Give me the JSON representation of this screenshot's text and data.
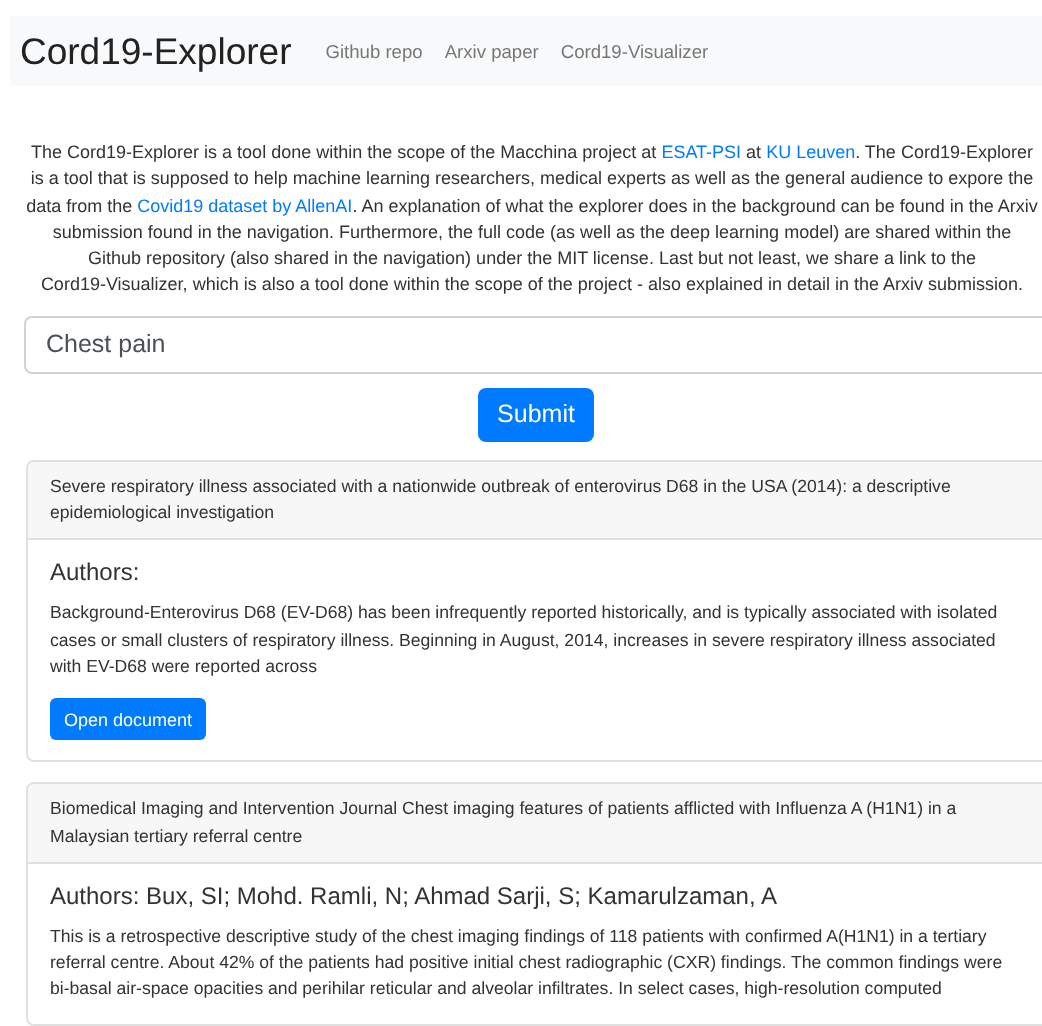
{
  "navbar": {
    "brand": "Cord19-Explorer",
    "links": [
      "Github repo",
      "Arxiv paper",
      "Cord19-Visualizer"
    ]
  },
  "intro": [
    {
      "kind": "text",
      "text": "The Cord19-Explorer is a tool done within the scope of the Macchina project at "
    },
    {
      "kind": "link",
      "text": "ESAT-PSI"
    },
    {
      "kind": "text",
      "text": " at "
    },
    {
      "kind": "link",
      "text": "KU Leuven"
    },
    {
      "kind": "text",
      "text": ". The Cord19-Explorer is a tool that is supposed to help machine learning researchers, medical experts as well as the general audience to expore the data from the "
    },
    {
      "kind": "link",
      "text": "Covid19 dataset by AllenAI"
    },
    {
      "kind": "text",
      "text": ". An explanation of what the explorer does in the background can be found in the Arxiv submission found in the navigation. Furthermore, the full code (as well as the deep learning model) are shared within the Github repository (also shared in the navigation) under the MIT license. Last but not least, we share a link to the Cord19-Visualizer, which is also a tool done within the scope of the project - also explained in detail in the Arxiv submission."
    }
  ],
  "search": {
    "value": "Chest pain"
  },
  "submit": "Submit",
  "results": [
    {
      "title": "Severe respiratory illness associated with a nationwide outbreak of enterovirus D68 in the USA (2014): a descriptive epidemiological investigation",
      "authors": "Authors:",
      "abstract": "Background-Enterovirus D68 (EV-D68) has been infrequently reported historically, and is typically associated with isolated cases or small clusters of respiratory illness. Beginning in August, 2014, increases in severe respiratory illness associated with EV-D68 were reported across",
      "button": "Open document"
    },
    {
      "title": "Biomedical Imaging and Intervention Journal Chest imaging features of patients afflicted with Influenza A (H1N1) in a Malaysian tertiary referral centre",
      "authors": "Authors: Bux, SI; Mohd. Ramli, N; Ahmad Sarji, S; Kamarulzaman, A",
      "abstract": "This is a retrospective descriptive study of the chest imaging findings of 118 patients with confirmed A(H1N1) in a tertiary referral centre. About 42% of the patients had positive initial chest radiographic (CXR) findings. The common findings were bi-basal air-space opacities and perihilar reticular and alveolar infiltrates. In select cases, high-resolution computed"
    }
  ]
}
